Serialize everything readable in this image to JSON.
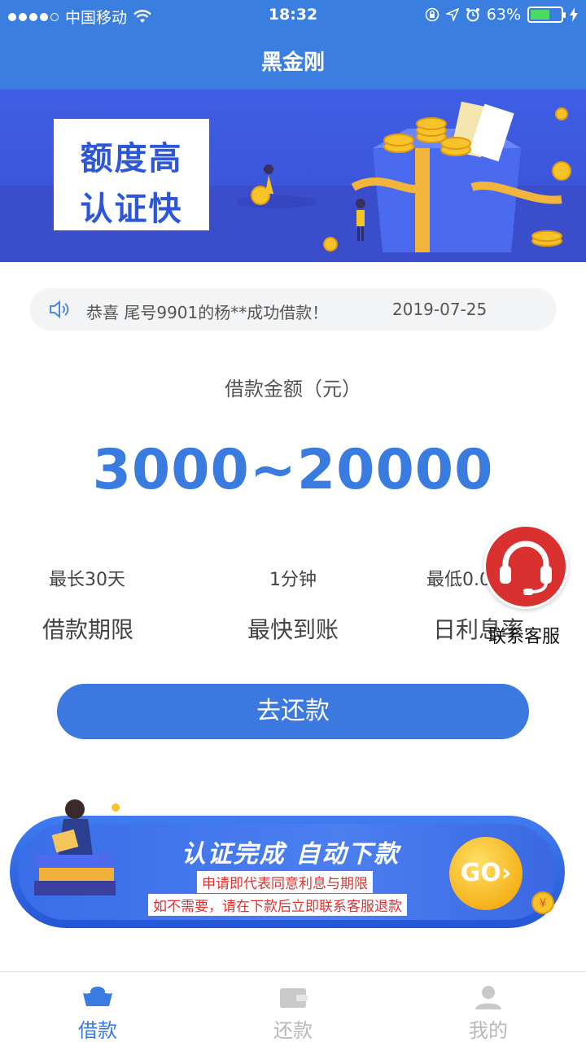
{
  "status_bar": {
    "carrier": "中国移动",
    "time": "18:32",
    "battery": "63%",
    "battery_level": 0.63
  },
  "nav": {
    "title": "黑金刚"
  },
  "banner": {
    "line1": "额度高",
    "line2": "认证快"
  },
  "notice": {
    "text": "恭喜 尾号9901的杨**成功借款！",
    "date": "2019-07-25"
  },
  "loan": {
    "amount_label": "借款金额（元）",
    "amount_range": "3000~20000"
  },
  "info": [
    {
      "value": "最长30天",
      "label": "借款期限"
    },
    {
      "value": "1分钟",
      "label": "最快到账"
    },
    {
      "value": "最低0.0",
      "label": "日利息率"
    }
  ],
  "customer_service": {
    "label": "联系客服"
  },
  "repay_button": {
    "label": "去还款"
  },
  "promo": {
    "title": "认证完成 自动下款",
    "line1": "申请即代表同意利息与期限",
    "line2": "如不需要，请在下款后立即联系客服退款",
    "go": "GO›"
  },
  "tabs": [
    {
      "label": "借款",
      "icon": "ingot-icon",
      "active": true
    },
    {
      "label": "还款",
      "icon": "wallet-icon",
      "active": false
    },
    {
      "label": "我的",
      "icon": "user-icon",
      "active": false
    }
  ],
  "colors": {
    "primary": "#3a7be0",
    "alert": "#d93030",
    "tab_inactive": "#b8b8b8"
  }
}
